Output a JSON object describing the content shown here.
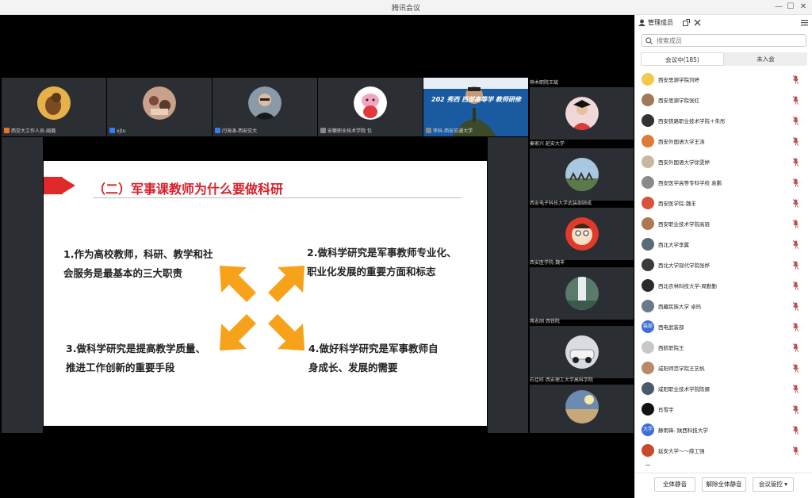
{
  "window": {
    "title": "腾讯会议",
    "minimize": "—",
    "maximize": "☐",
    "close": "✕"
  },
  "top_tiles": [
    {
      "name": "西交大工作人员-闽璐"
    },
    {
      "name": "xjtu"
    },
    {
      "name": "闫海涛-西安交大"
    },
    {
      "name": "安徽职业技术学院 包"
    },
    {
      "name": "李科-西安交通大学",
      "screen_text": "202 秀西 西部高等学 教师研修 "
    }
  ],
  "side_tiles": [
    {
      "name": "神木职院王斌"
    },
    {
      "name": "秦家兴 延安大学"
    },
    {
      "name": "西安电子科技大学武装部顾成"
    },
    {
      "name": "西安医学院-魏丰"
    },
    {
      "name": "蒋永刚 西铁院"
    },
    {
      "name": "石佳旺 西安理工大学高科学院"
    },
    {
      "name": ""
    }
  ],
  "slide": {
    "heading": "（二）军事课教师为什么要做科研",
    "points": [
      {
        "l1": "1.作为高校教师，科研、教学和社",
        "l2": "会服务是最基本的三大职责"
      },
      {
        "l1": "2.做科学研究是军事教师专业化、",
        "l2": "职业化发展的重要方面和标志"
      },
      {
        "l1": "3.做科学研究是提高教学质量、",
        "l2": "推进工作创新的重要手段"
      },
      {
        "l1": "4.做好科学研究是军事教师自",
        "l2": "身成长、发展的需要"
      }
    ]
  },
  "panel": {
    "title": "管理成员",
    "search_placeholder": "搜索成员",
    "tab_in": "会议中(185)",
    "tab_out": "未入会",
    "members": [
      {
        "name": "西安思源学院刘婷",
        "color": "#f2c94c",
        "badge": ""
      },
      {
        "name": "西安思源学院张红",
        "color": "#a0785a",
        "badge": ""
      },
      {
        "name": "西安铁路职业技术学院＋朱彤",
        "color": "#333333",
        "badge": ""
      },
      {
        "name": "西安外国语大学王涛",
        "color": "#e07a3a",
        "badge": ""
      },
      {
        "name": "西安外国语大学徐雯婷",
        "color": "#c9b8a0",
        "badge": ""
      },
      {
        "name": "西安医学高等专科学校 袁鹏",
        "color": "#8a8a8a",
        "badge": ""
      },
      {
        "name": "西安医学院-魏丰",
        "color": "#d9533a",
        "badge": ""
      },
      {
        "name": "西安职业技术学院高骁",
        "color": "#b07850",
        "badge": ""
      },
      {
        "name": "西北大学李翼",
        "color": "#5a6a7a",
        "badge": ""
      },
      {
        "name": "西北大学现代学院张烨",
        "color": "#3a3a3a",
        "badge": ""
      },
      {
        "name": "西北农林科技大学-周勤勤",
        "color": "#2a2a2a",
        "badge": ""
      },
      {
        "name": "西藏民族大学 卓玛",
        "color": "#6a7a8a",
        "badge": ""
      },
      {
        "name": "西电武装部",
        "color": "#3d6fd9",
        "badge": "装部"
      },
      {
        "name": "西航职院王",
        "color": "#c8c8c8",
        "badge": ""
      },
      {
        "name": "咸阳师范学院王艺帆",
        "color": "#b88a6a",
        "badge": ""
      },
      {
        "name": "咸阳职业技术学院陈娜",
        "color": "#4a5a6a",
        "badge": ""
      },
      {
        "name": "肖雪宇",
        "color": "#111111",
        "badge": ""
      },
      {
        "name": "静雨锋- 陕西科技大学",
        "color": "#3d6fd9",
        "badge": "大学"
      },
      {
        "name": "延安大学～～薛工强",
        "color": "#c94a2a",
        "badge": ""
      },
      {
        "name": "延安职业技术学院",
        "color": "#7a6a5a",
        "badge": ""
      }
    ],
    "btn_mute_all": "全体静音",
    "btn_unmute_all": "解除全体静音",
    "btn_control": "会议管控 ▾"
  },
  "colors": {
    "accent_red": "#d9202a",
    "arrow_orange": "#f7a21b",
    "active_tile": "#23b465"
  }
}
